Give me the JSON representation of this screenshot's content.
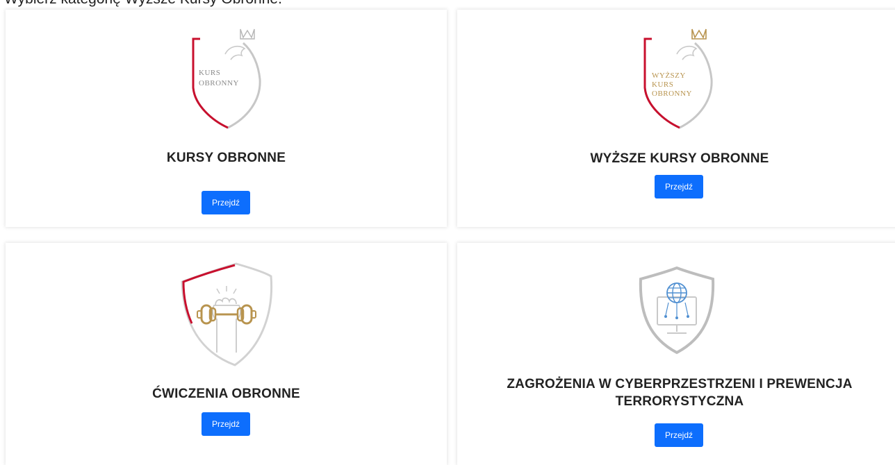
{
  "instruction": "Wybierz kategorię Wyższe Kursy Obronne.",
  "cards": [
    {
      "title": "KURSY OBRONNE",
      "logo_text": [
        "KURS",
        "OBRONNY"
      ],
      "button": "Przejdź"
    },
    {
      "title": "WYŻSZE KURSY OBRONNE",
      "logo_text": [
        "WYŻSZY",
        "KURS",
        "OBRONNY"
      ],
      "button": "Przejdź"
    },
    {
      "title": "ĆWICZENIA OBRONNE",
      "button": "Przejdź"
    },
    {
      "title_lines": [
        "ZAGROŻENIA W CYBERPRZESTRZENI I PREWENCJA",
        "TERRORYSTYCZNA"
      ],
      "button": "Przejdź"
    }
  ],
  "colors": {
    "button": "#0d6efd",
    "shield_red": "#c8102e",
    "gold": "#b8944f",
    "logo_text_gray": "#8a8a8a",
    "cyber_blue": "#4f8fd1"
  }
}
